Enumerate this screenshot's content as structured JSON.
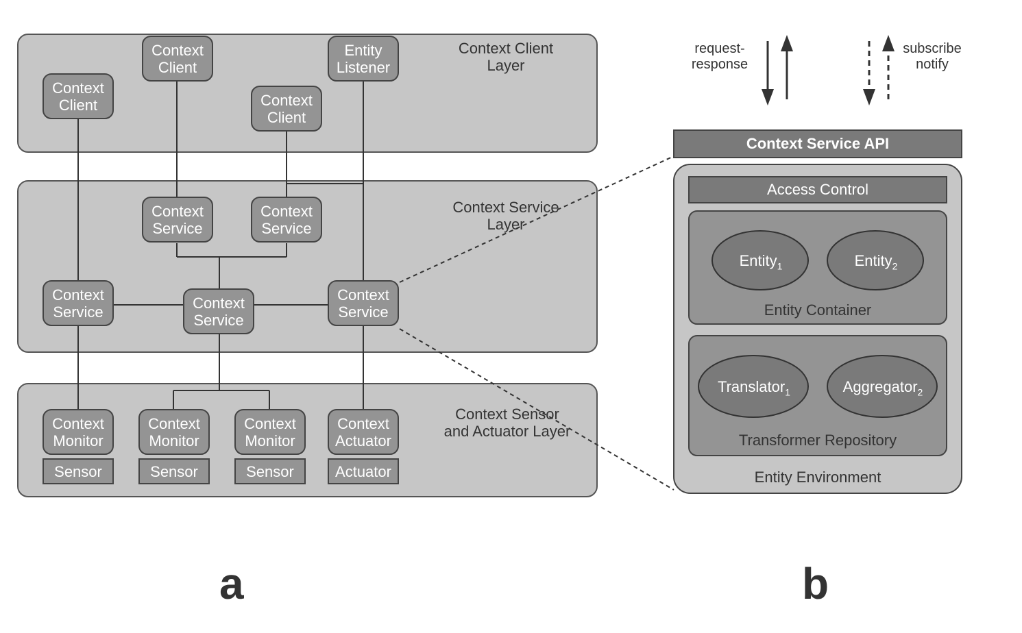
{
  "layers": {
    "client_title": "Context Client\nLayer",
    "service_title": "Context Service\nLayer",
    "sensor_title": "Context Sensor\nand Actuator Layer"
  },
  "nodes": {
    "context_client_1": "Context\nClient",
    "context_client_2": "Context\nClient",
    "context_client_3": "Context\nClient",
    "entity_listener": "Entity\nListener",
    "context_service_1": "Context\nService",
    "context_service_2": "Context\nService",
    "context_service_3": "Context\nService",
    "context_service_4": "Context\nService",
    "context_service_5": "Context\nService",
    "context_monitor_1": "Context\nMonitor",
    "context_monitor_2": "Context\nMonitor",
    "context_monitor_3": "Context\nMonitor",
    "context_actuator": "Context\nActuator",
    "sensor_1": "Sensor",
    "sensor_2": "Sensor",
    "sensor_3": "Sensor",
    "actuator": "Actuator"
  },
  "panel_b": {
    "api_title": "Context Service API",
    "access_control": "Access Control",
    "entity_1": "Entity",
    "entity_1_sub": "1",
    "entity_2": "Entity",
    "entity_2_sub": "2",
    "entity_container": "Entity Container",
    "translator": "Translator",
    "translator_sub": "1",
    "aggregator": "Aggregator",
    "aggregator_sub": "2",
    "transformer_repo": "Transformer Repository",
    "entity_env": "Entity Environment"
  },
  "legend": {
    "request_response": "request-\nresponse",
    "subscribe_notify": "subscribe\nnotify"
  },
  "figure_labels": {
    "a": "a",
    "b": "b"
  }
}
